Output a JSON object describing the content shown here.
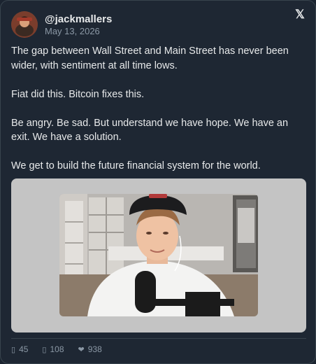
{
  "author": {
    "handle": "@jackmallers",
    "date": "May 13, 2026"
  },
  "tweet": {
    "paragraphs": [
      "The gap between Wall Street and Main Street has never been wider, with sentiment at all time lows.",
      "Fiat did this. Bitcoin fixes this.",
      "Be angry. Be sad. But understand we have hope. We have an exit. We have a solution.",
      "We get to build the future financial system for the world."
    ]
  },
  "stats": {
    "replies": "45",
    "retweets": "108",
    "likes": "938"
  },
  "icons": {
    "brand": "x-logo",
    "reply": "reply-icon",
    "retweet": "retweet-icon",
    "like": "heart-icon"
  },
  "colors": {
    "background": "#1e2733",
    "text": "#e7e9ea",
    "muted": "#8b98a5",
    "border": "#38444d",
    "media_frame": "#c4c4c4"
  }
}
